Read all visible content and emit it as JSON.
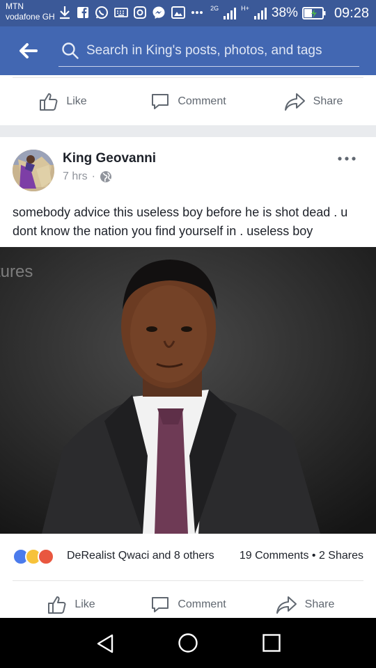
{
  "status_bar": {
    "carrier": "MTN",
    "network": "vodafone GH",
    "net_2g": "2G",
    "net_h": "H+",
    "battery": "38%",
    "time": "09:28"
  },
  "search": {
    "placeholder": "Search in King's posts, photos, and tags"
  },
  "actions_top": {
    "like": "Like",
    "comment": "Comment",
    "share": "Share"
  },
  "post": {
    "author": "King Geovanni",
    "time": "7 hrs",
    "separator": "·",
    "text": "somebody advice this useless boy before he is shot dead . u dont know the nation you find yourself in . useless boy",
    "photo_watermark": "tures",
    "reactions": {
      "names": "DeRealist Qwaci and 8 others",
      "counts": "19 Comments • 2 Shares",
      "colors": {
        "like": "#4b7bec",
        "haha": "#f7c23a",
        "angry": "#e9573f"
      }
    },
    "actions": {
      "like": "Like",
      "comment": "Comment",
      "share": "Share"
    }
  },
  "colors": {
    "header": "#4267b2",
    "status": "#3b5998",
    "icon_gray": "#606770"
  }
}
